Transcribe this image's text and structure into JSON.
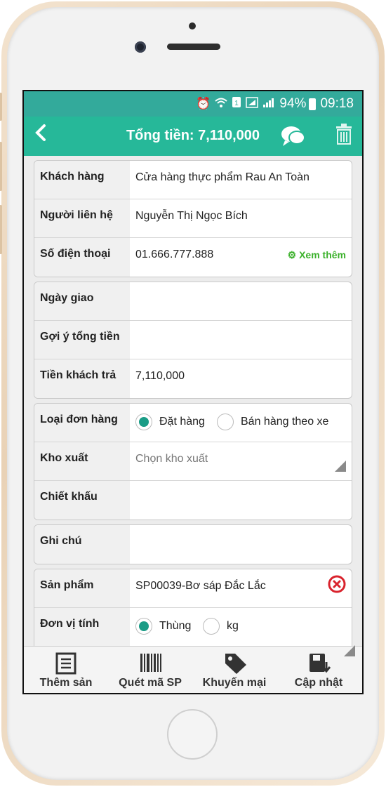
{
  "status_bar": {
    "battery": "94%",
    "time": "09:18",
    "icons": [
      "alarm-icon",
      "wifi-icon",
      "sim-icon",
      "signal-icon",
      "signal-icon",
      "battery-icon"
    ]
  },
  "header": {
    "back_icon": "chevron-left-icon",
    "title": "Tổng tiền: 7,110,000",
    "chat_icon": "chat-icon",
    "trash_icon": "trash-icon"
  },
  "customer": {
    "customer_label": "Khách hàng",
    "customer_value": "Cửa hàng thực phẩm Rau An Toàn",
    "contact_label": "Người liên hệ",
    "contact_value": "Nguyễn Thị Ngọc Bích",
    "phone_label": "Số điện thoại",
    "phone_value": "01.666.777.888",
    "more_label": "Xem thêm"
  },
  "payment": {
    "delivery_label": "Ngày giao",
    "delivery_value": "",
    "suggest_label": "Gợi ý tổng tiền",
    "suggest_value": "",
    "paid_label": "Tiền khách trả",
    "paid_value": "7,110,000"
  },
  "order": {
    "type_label": "Loại đơn hàng",
    "type_options": [
      "Đặt hàng",
      "Bán hàng theo xe"
    ],
    "type_selected": "Đặt hàng",
    "warehouse_label": "Kho xuất",
    "warehouse_placeholder": "Chọn kho xuất",
    "discount_label": "Chiết khấu",
    "discount_value": ""
  },
  "note": {
    "label": "Ghi chú",
    "value": ""
  },
  "product": {
    "product_label": "Sản phẩm",
    "product_value": "SP00039-Bơ sáp Đắc Lắc",
    "unit_label": "Đơn vị tính",
    "unit_options": [
      "Thùng",
      "kg"
    ],
    "unit_selected": "Thùng"
  },
  "tabbar": {
    "items": [
      {
        "label": "Thêm sản",
        "icon": "list-icon"
      },
      {
        "label": "Quét mã SP",
        "icon": "barcode-icon"
      },
      {
        "label": "Khuyến mại",
        "icon": "tag-icon"
      },
      {
        "label": "Cập nhật",
        "icon": "save-icon"
      }
    ]
  },
  "colors": {
    "status_bar": "#33aa9b",
    "header": "#26b899",
    "radio_accent": "#1a9c86",
    "link_green": "#3bb12b",
    "remove_red": "#d9232d"
  }
}
